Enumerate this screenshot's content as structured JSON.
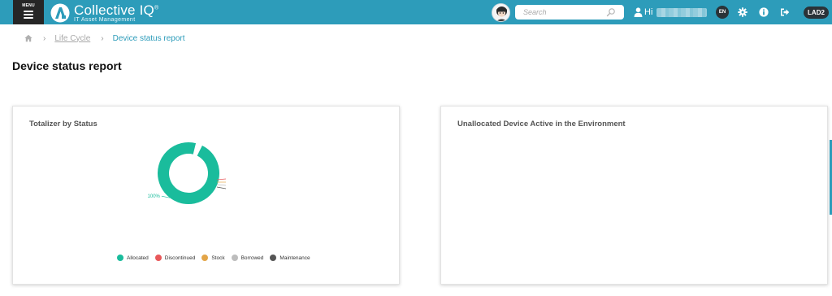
{
  "header": {
    "menu_label": "MENU",
    "brand_name": "Collective IQ",
    "brand_registered": "®",
    "brand_tagline": "IT Asset Management",
    "search_placeholder": "Search",
    "greeting": "Hi",
    "language": "EN",
    "tenant": "LAD2",
    "accent_color": "#2d9cba"
  },
  "breadcrumb": {
    "home_icon": "home-icon",
    "items": [
      "Life Cycle",
      "Device status report"
    ]
  },
  "page": {
    "title": "Device status report"
  },
  "cards": {
    "left": {
      "title": "Totalizer by Status",
      "chart_data": {
        "type": "pie",
        "donut": true,
        "title": "Totalizer by Status",
        "categories": [
          "Allocated",
          "Discontinued",
          "Stock",
          "Borrowed",
          "Maintenance"
        ],
        "values": [
          100,
          0,
          0,
          0,
          0
        ],
        "slice_label": "100%",
        "colors": [
          "#1abc9c",
          "#e8585a",
          "#e3a548",
          "#bdbdbd",
          "#555555"
        ],
        "legend": "bottom"
      }
    },
    "right": {
      "title": "Unallocated Device Active in the Environment"
    }
  }
}
